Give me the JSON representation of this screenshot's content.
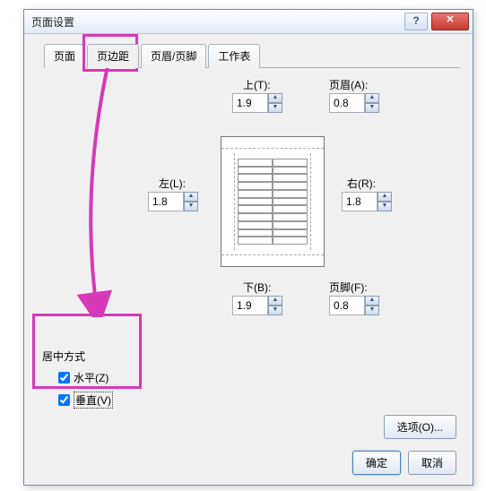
{
  "title": "页面设置",
  "tabs": [
    {
      "label": "页面",
      "active": false
    },
    {
      "label": "页边距",
      "active": true
    },
    {
      "label": "页眉/页脚",
      "active": false
    },
    {
      "label": "工作表",
      "active": false
    }
  ],
  "margins": {
    "top": {
      "label": "上(T):",
      "value": "1.9"
    },
    "header": {
      "label": "页眉(A):",
      "value": "0.8"
    },
    "left": {
      "label": "左(L):",
      "value": "1.8"
    },
    "right": {
      "label": "右(R):",
      "value": "1.8"
    },
    "bottom": {
      "label": "下(B):",
      "value": "1.9"
    },
    "footer": {
      "label": "页脚(F):",
      "value": "0.8"
    }
  },
  "center": {
    "title": "居中方式",
    "horizontal": {
      "label": "水平(Z)",
      "checked": true
    },
    "vertical": {
      "label": "垂直(V)",
      "checked": true
    }
  },
  "buttons": {
    "options": "选项(O)...",
    "ok": "确定",
    "cancel": "取消"
  },
  "titlebar": {
    "help": "?",
    "close": "✕"
  }
}
